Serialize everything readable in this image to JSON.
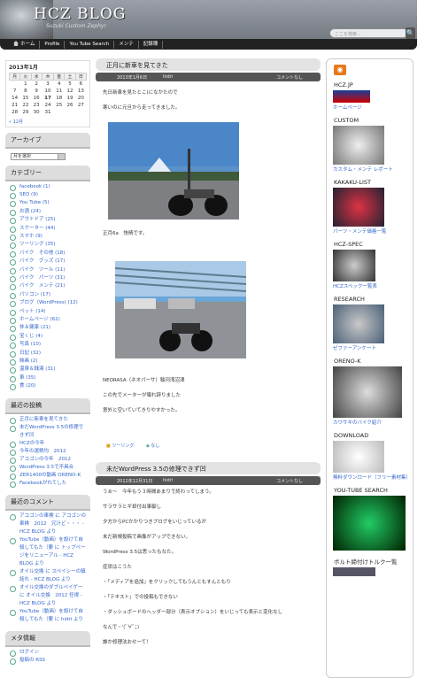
{
  "header": {
    "title": "HCZ BLOG",
    "subtitle": "Suzuki Custom Zephyr",
    "search_placeholder": "ここを検索...",
    "search_button": "🔍"
  },
  "nav": [
    {
      "label": "ホーム"
    },
    {
      "label": "Profile"
    },
    {
      "label": "You Tube Search"
    },
    {
      "label": "メンテ"
    },
    {
      "label": "記録簿"
    }
  ],
  "calendar": {
    "caption": "2013年1月",
    "days": [
      "月",
      "火",
      "水",
      "木",
      "金",
      "土",
      "日"
    ],
    "weeks": [
      [
        "",
        "1",
        "2",
        "3",
        "4",
        "5",
        "6"
      ],
      [
        "7",
        "8",
        "9",
        "10",
        "11",
        "12",
        "13"
      ],
      [
        "14",
        "15",
        "16",
        "17",
        "18",
        "19",
        "20"
      ],
      [
        "21",
        "22",
        "23",
        "24",
        "25",
        "26",
        "27"
      ],
      [
        "28",
        "29",
        "30",
        "31",
        "",
        "",
        ""
      ]
    ],
    "prev": "« 12月"
  },
  "archive": {
    "title": "アーカイブ",
    "select": "月を選択"
  },
  "categories": {
    "title": "カテゴリー",
    "items": [
      "facebook (1)",
      "SEO (9)",
      "You Tube (5)",
      "お酒 (24)",
      "アウトドア (25)",
      "スクーター (44)",
      "スマホ (9)",
      "ツーリング (35)",
      "バイク　その他 (18)",
      "バイク　グッズ (17)",
      "バイク　ツール (11)",
      "バイク　パーツ (31)",
      "バイク　メンテ (21)",
      "パソコン (17)",
      "ブログ（WordPress) (12)",
      "ペット (14)",
      "ホームページ (62)",
      "休＆健康 (21)",
      "宝くじ (4)",
      "写真 (10)",
      "日記 (32)",
      "映画 (2)",
      "温泉＆銭湯 (31)",
      "車 (35)",
      "食 (20)"
    ]
  },
  "recent_posts": {
    "title": "最近の投稿",
    "items": [
      "正月に新車を見てきた",
      "未だWordPress 3.5の修理できず凹",
      "HCZの今年",
      "今年の運勢均　2012",
      "アコゴンの今年　2012",
      "WordPress 3.5で不具合",
      "ZER1400の動画 ORENO-K",
      "Facebookがれてした"
    ]
  },
  "recent_comments": {
    "title": "最近のコメント",
    "items": [
      "アコゴンの車検 に アコゴンの車検　2012　冗汁ど・・・ - HCZ BLOG より",
      "YouTube（動画）を設けて自殺してもた（要 に トップページをリニューアル - HCZ BLOG より",
      "オイル交換 に スペイシーの鎮話れ - HCZ BLOG より",
      "オイル交換のダブルペイゲー に オイル交換　2012 任視 - HCZ BLOG より",
      "YouTube（動画）を設けて自殺してもた（要 に hidri より"
    ]
  },
  "meta": {
    "title": "メタ情報",
    "items": [
      "ログイン",
      "投稿の RSS"
    ]
  },
  "posts": [
    {
      "title": "正月に新車を見てきた",
      "date": "2013年1月6日",
      "author": "hidri",
      "comments": "コメントなし",
      "lines": [
        "先日新車を見たとこ(になかたので",
        "寒いのに元旦から走ってきました。",
        "",
        "正月6a　快晴です。",
        "",
        "NEORASA（ネオパーサ）駿河湾沼津",
        "この先でメーターが壊れ辞りました",
        "意外と空いていてきりやすかった。"
      ],
      "foot_tag": "ツーリング",
      "foot_tag2": "なし"
    },
    {
      "title": "未だWordPress 3.5の修理できず凹",
      "date": "2012年12月31日",
      "author": "hidri",
      "comments": "コメントなし",
      "lines": [
        "うぁ〜　今年もう３時間あまりで終わってしまう。",
        "サラサラとギ却付出事御し",
        "夕方からPCかかりつきブログをいじっているが",
        "未だ新規投稿で画像がアップできない。",
        "WordPress 3.5は思ったもなた。",
        "症状はこうた",
        "・「メディアを追加」をクリックしてもうんともすんともり",
        "・「テキスト」での投稿もできない",
        "・ダッシュボードのヘッダー部分（表示オプション）をいじっても表示と変化なし",
        "なんで・'(ﾟ∀ﾟ；)",
        "誰か修理法おせーて！"
      ]
    }
  ],
  "sidebar": {
    "rss_label": "RSS",
    "sections": [
      {
        "title": "HCZ.JP",
        "caption": "ホームページ"
      },
      {
        "title": "CUSTOM",
        "caption": "カスタム・メンテ レポート"
      },
      {
        "title": "KAKAKU-LIST",
        "caption": "パーツ・メンテ価格一覧"
      },
      {
        "title": "HCZ-SPEC",
        "caption": "HCZスペック一覧表"
      },
      {
        "title": "RESEARCH",
        "caption": "ゼファーアンケート"
      },
      {
        "title": "ORENO-K",
        "caption": "カワサキのバイク紹介"
      },
      {
        "title": "DOWNLOAD",
        "caption": "無料ダウンロード（フリー素材集）"
      },
      {
        "title": "YOU-TUBE SEARCH",
        "caption": ""
      },
      {
        "title": "ボルト締付けトルク一覧",
        "caption": ""
      }
    ]
  },
  "colors": {
    "accent": "#3366cc",
    "header": "#7a8088",
    "nav": "#222222"
  }
}
